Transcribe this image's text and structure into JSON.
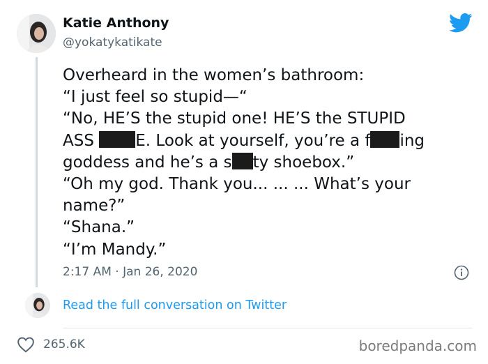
{
  "author": {
    "name": "Katie Anthony",
    "handle": "@yokatykatikate"
  },
  "tweet": {
    "lines": [
      [
        "Overheard in the women’s bathroom:"
      ],
      [
        "“I just feel so stupid—“"
      ],
      [
        "“No, HE’S the stupid one! HE’S the STUPID"
      ],
      [
        "ASS ",
        "",
        "E. Look at yourself, you’re a f",
        "",
        "ing"
      ],
      [
        "goddess and he’s a s",
        "",
        "ty shoebox.”"
      ],
      [
        "“Oh my god. Thank you... ... ... What’s your"
      ],
      [
        "name?”"
      ],
      [
        "“Shana.”"
      ],
      [
        "“I’m Mandy.”"
      ]
    ],
    "timestamp": "2:17 AM · Jan 26, 2020"
  },
  "thread_link": "Read the full conversation on Twitter",
  "likes": "265.6K",
  "watermark": "boredpanda.com",
  "colors": {
    "brand": "#1d9bf0",
    "text": "#0f1419",
    "muted": "#536471"
  },
  "icons": {
    "logo": "twitter-bird-icon",
    "info": "info-icon",
    "like": "heart-icon"
  }
}
